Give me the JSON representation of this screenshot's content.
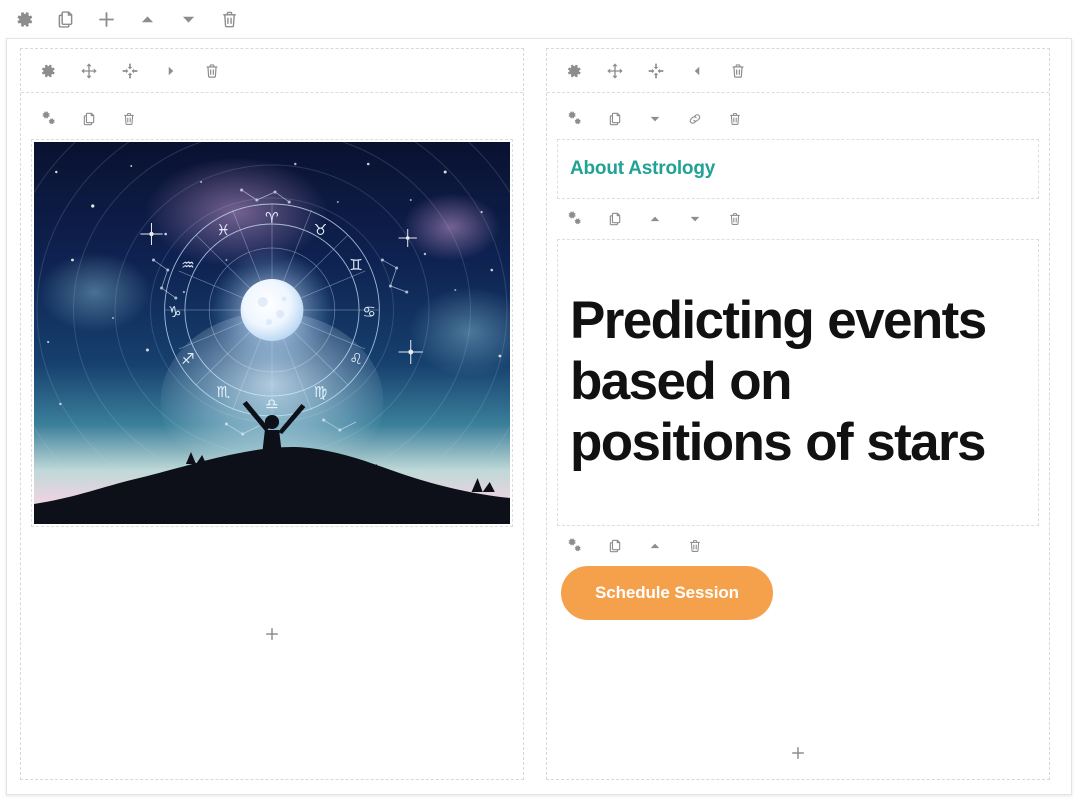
{
  "row_toolbar": {
    "items": [
      {
        "name": "settings-icon",
        "icon": "gear",
        "label": "Settings"
      },
      {
        "name": "duplicate-icon",
        "icon": "copy",
        "label": "Duplicate"
      },
      {
        "name": "add-icon",
        "icon": "plus",
        "label": "Add"
      },
      {
        "name": "move-up-icon",
        "icon": "caret-up",
        "label": "Move up"
      },
      {
        "name": "move-down-icon",
        "icon": "caret-down",
        "label": "Move down"
      },
      {
        "name": "delete-icon",
        "icon": "trash",
        "label": "Delete"
      }
    ]
  },
  "left_column": {
    "toolbar": [
      {
        "name": "column-settings-icon",
        "icon": "gear",
        "label": "Column settings"
      },
      {
        "name": "move-icon",
        "icon": "arrows-move",
        "label": "Move column"
      },
      {
        "name": "resize-icon",
        "icon": "arrows-in",
        "label": "Resize column"
      },
      {
        "name": "collapse-right-icon",
        "icon": "caret-right",
        "label": "Collapse right"
      },
      {
        "name": "delete-icon",
        "icon": "trash",
        "label": "Delete column"
      }
    ],
    "image_block": {
      "toolbar": [
        {
          "name": "block-settings-icon",
          "icon": "gears",
          "label": "Block settings"
        },
        {
          "name": "duplicate-icon",
          "icon": "copy",
          "label": "Duplicate block"
        },
        {
          "name": "delete-icon",
          "icon": "trash",
          "label": "Delete block"
        }
      ],
      "image_alt": "Person silhouette on hilltop with arms raised beneath a glowing moon encircled by a zodiac wheel in a starry night sky"
    },
    "add_block_label": "+"
  },
  "right_column": {
    "toolbar": [
      {
        "name": "column-settings-icon",
        "icon": "gear",
        "label": "Column settings"
      },
      {
        "name": "move-icon",
        "icon": "arrows-move",
        "label": "Move column"
      },
      {
        "name": "resize-icon",
        "icon": "arrows-in",
        "label": "Resize column"
      },
      {
        "name": "collapse-left-icon",
        "icon": "caret-left",
        "label": "Collapse left"
      },
      {
        "name": "delete-icon",
        "icon": "trash",
        "label": "Delete column"
      }
    ],
    "about_block": {
      "toolbar": [
        {
          "name": "block-settings-icon",
          "icon": "gears",
          "label": "Block settings"
        },
        {
          "name": "duplicate-icon",
          "icon": "copy",
          "label": "Duplicate block"
        },
        {
          "name": "move-down-icon",
          "icon": "caret-down",
          "label": "Move down"
        },
        {
          "name": "link-icon",
          "icon": "link",
          "label": "Link"
        },
        {
          "name": "delete-icon",
          "icon": "trash",
          "label": "Delete block"
        }
      ],
      "text": "About Astrology"
    },
    "headline_block": {
      "toolbar": [
        {
          "name": "block-settings-icon",
          "icon": "gears",
          "label": "Block settings"
        },
        {
          "name": "duplicate-icon",
          "icon": "copy",
          "label": "Duplicate block"
        },
        {
          "name": "move-up-icon",
          "icon": "caret-up",
          "label": "Move up"
        },
        {
          "name": "move-down-icon",
          "icon": "caret-down",
          "label": "Move down"
        },
        {
          "name": "delete-icon",
          "icon": "trash",
          "label": "Delete block"
        }
      ],
      "text": "Predicting events based on positions of stars"
    },
    "button_block": {
      "toolbar": [
        {
          "name": "block-settings-icon",
          "icon": "gears",
          "label": "Block settings"
        },
        {
          "name": "duplicate-icon",
          "icon": "copy",
          "label": "Duplicate block"
        },
        {
          "name": "move-up-icon",
          "icon": "caret-up",
          "label": "Move up"
        },
        {
          "name": "delete-icon",
          "icon": "trash",
          "label": "Delete block"
        }
      ],
      "label": "Schedule Session"
    },
    "add_block_label": "+"
  },
  "colors": {
    "accent_teal": "#21a294",
    "button_orange": "#f5a04b",
    "icon_grey": "#8d8d8d",
    "heading_black": "#111111",
    "border_dashed": "#dcdcdc"
  }
}
